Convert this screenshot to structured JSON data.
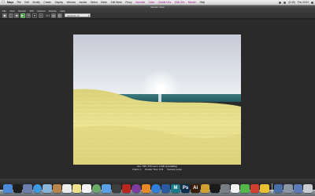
{
  "menubar": {
    "apple": "",
    "items": [
      "Maya",
      "File",
      "Edit",
      "Modify",
      "Create",
      "Display",
      "Window",
      "Assets",
      "Select",
      "Mesh",
      "Edit Mesh",
      "Proxy",
      "Normals",
      "Color",
      "Create UVs",
      "Edit UVs",
      "Muscle",
      "Help"
    ],
    "active_item": "Maya",
    "status": [
      "(0:49)",
      "Thu 20:51"
    ]
  },
  "window": {
    "title": "Render View",
    "menus": [
      "File",
      "View",
      "Render",
      "IPR",
      "Options",
      "Display",
      "Help"
    ]
  },
  "toolbar": {
    "buttons": [
      "render-frame",
      "render-region",
      "snapshot",
      "ipr-render",
      "refresh-ipr",
      "display-rgb",
      "display-alpha",
      "keep-image",
      "remove-image"
    ],
    "ratio": "1:1",
    "camera_select": "camera1 ca",
    "accent": "#3b8d3d"
  },
  "render": {
    "sky_top": "#c8ccd6",
    "horizon": "#e7ebef",
    "sea": "#2e6a72",
    "grass_light": "#f4ee9e",
    "grass_dark": "#cfc36c",
    "caption_line1": "size: 768 x 576 zoom: 0.400",
    "caption_line2": "(mentalRay)",
    "frame": "Frame: 1",
    "render_time": "Render Time: 0:41",
    "camera": "Camera: persp"
  },
  "dock": {
    "icons": [
      {
        "name": "finder",
        "color": "#4a8ad8",
        "glyph": ""
      },
      {
        "name": "dashboard",
        "color": "#1e1e1e",
        "glyph": ""
      },
      {
        "name": "mission-control",
        "color": "#6a7fb0",
        "glyph": ""
      },
      {
        "name": "safari",
        "color": "#3d9ae0",
        "glyph": ""
      },
      {
        "name": "mail",
        "color": "#8ab3d8",
        "glyph": ""
      },
      {
        "name": "contacts",
        "color": "#b8864a",
        "glyph": ""
      },
      {
        "name": "calendar",
        "color": "#ededed",
        "glyph": ""
      },
      {
        "name": "notes",
        "color": "#f0e28a",
        "glyph": ""
      },
      {
        "name": "reminders",
        "color": "#f4f4f4",
        "glyph": ""
      },
      {
        "name": "maps",
        "color": "#6aa96a",
        "glyph": ""
      },
      {
        "name": "messages",
        "color": "#5aa0e8",
        "glyph": ""
      },
      {
        "name": "facetime",
        "color": "#3e3e3e",
        "glyph": ""
      },
      {
        "name": "photo-booth",
        "color": "#b8261e",
        "glyph": ""
      },
      {
        "name": "itunes",
        "color": "#7d3c9e",
        "glyph": ""
      },
      {
        "name": "ibooks",
        "color": "#e88a28",
        "glyph": ""
      },
      {
        "name": "app-store",
        "color": "#2e7fd8",
        "glyph": ""
      },
      {
        "name": "preview",
        "color": "#2c5aa0",
        "glyph": ""
      },
      {
        "name": "maya",
        "color": "#1b7a8a",
        "glyph": "M"
      },
      {
        "name": "photoshop",
        "color": "#0d2e4e",
        "glyph": "Ps"
      },
      {
        "name": "illustrator",
        "color": "#3b1e08",
        "glyph": "Ai"
      },
      {
        "name": "garageband",
        "color": "#d0a030",
        "glyph": ""
      },
      {
        "name": "terminal",
        "color": "#1a1a1a",
        "glyph": ""
      },
      {
        "name": "system-preferences",
        "color": "#7a7f86",
        "glyph": ""
      },
      {
        "name": "textedit",
        "color": "#f2f2f2",
        "glyph": ""
      },
      {
        "name": "utility-1",
        "color": "#55b84a",
        "glyph": ""
      },
      {
        "name": "utility-2",
        "color": "#d04030",
        "glyph": ""
      },
      {
        "name": "utility-3",
        "color": "#e8c030",
        "glyph": ""
      },
      {
        "name": "downloads-stack",
        "color": "#4a6ea8",
        "glyph": ""
      },
      {
        "name": "documents-stack",
        "color": "#8a96a8",
        "glyph": ""
      },
      {
        "name": "applications-stack",
        "color": "#5a7ab8",
        "glyph": ""
      },
      {
        "name": "trash",
        "color": "#c8ccd0",
        "glyph": ""
      }
    ]
  }
}
